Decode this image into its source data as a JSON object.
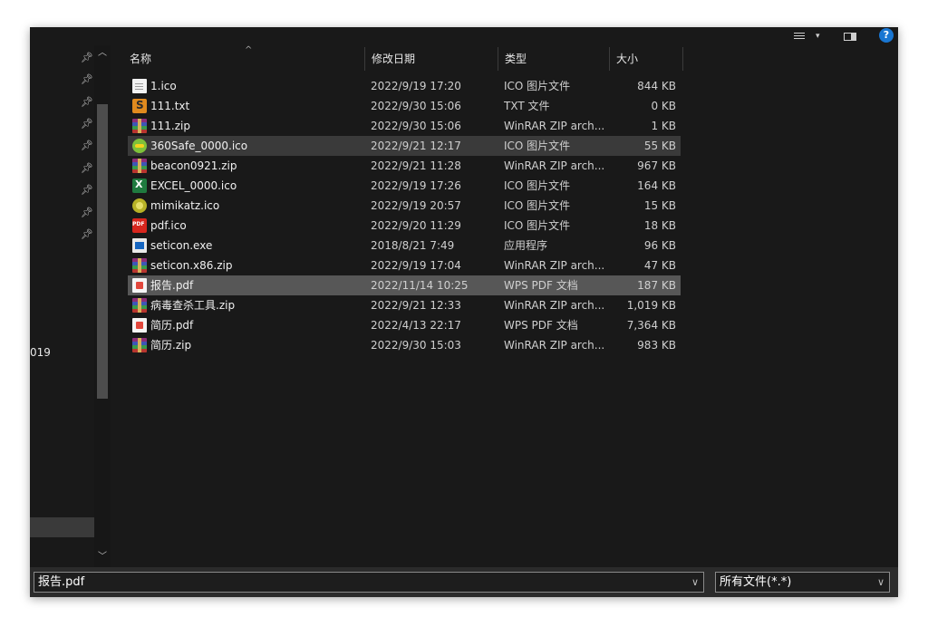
{
  "header": {
    "help_label": "?",
    "view_dropdown": "▾"
  },
  "nav": {
    "year_fragment": "019",
    "scroll_up": "︿",
    "scroll_down": "﹀"
  },
  "columns": {
    "name": "名称",
    "date": "修改日期",
    "type": "类型",
    "size": "大小",
    "sort_indicator": "^"
  },
  "files": [
    {
      "name": "1.ico",
      "date": "2022/9/19 17:20",
      "type": "ICO 图片文件",
      "size": "844 KB",
      "icon": "ico-doc-icon"
    },
    {
      "name": "111.txt",
      "date": "2022/9/30 15:06",
      "type": "TXT 文件",
      "size": "0 KB",
      "icon": "sublime-text-icon"
    },
    {
      "name": "111.zip",
      "date": "2022/9/30 15:06",
      "type": "WinRAR ZIP arch...",
      "size": "1 KB",
      "icon": "winrar-zip-icon"
    },
    {
      "name": "360Safe_0000.ico",
      "date": "2022/9/21 12:17",
      "type": "ICO 图片文件",
      "size": "55 KB",
      "icon": "360-safe-icon"
    },
    {
      "name": "beacon0921.zip",
      "date": "2022/9/21 11:28",
      "type": "WinRAR ZIP arch...",
      "size": "967 KB",
      "icon": "winrar-zip-icon"
    },
    {
      "name": "EXCEL_0000.ico",
      "date": "2022/9/19 17:26",
      "type": "ICO 图片文件",
      "size": "164 KB",
      "icon": "excel-icon"
    },
    {
      "name": "mimikatz.ico",
      "date": "2022/9/19 20:57",
      "type": "ICO 图片文件",
      "size": "15 KB",
      "icon": "kiwi-icon"
    },
    {
      "name": "pdf.ico",
      "date": "2022/9/20 11:29",
      "type": "ICO 图片文件",
      "size": "18 KB",
      "icon": "pdf-icon"
    },
    {
      "name": "seticon.exe",
      "date": "2018/8/21 7:49",
      "type": "应用程序",
      "size": "96 KB",
      "icon": "exe-icon"
    },
    {
      "name": "seticon.x86.zip",
      "date": "2022/9/19 17:04",
      "type": "WinRAR ZIP arch...",
      "size": "47 KB",
      "icon": "winrar-zip-icon"
    },
    {
      "name": "报告.pdf",
      "date": "2022/11/14 10:25",
      "type": "WPS PDF 文档",
      "size": "187 KB",
      "icon": "wps-pdf-icon"
    },
    {
      "name": "病毒查杀工具.zip",
      "date": "2022/9/21 12:33",
      "type": "WinRAR ZIP arch...",
      "size": "1,019 KB",
      "icon": "winrar-zip-icon"
    },
    {
      "name": "简历.pdf",
      "date": "2022/4/13 22:17",
      "type": "WPS PDF 文档",
      "size": "7,364 KB",
      "icon": "wps-pdf-icon"
    },
    {
      "name": "简历.zip",
      "date": "2022/9/30 15:03",
      "type": "WinRAR ZIP arch...",
      "size": "983 KB",
      "icon": "winrar-zip-icon"
    }
  ],
  "hovered_row": "360Safe_0000.ico",
  "selected_row": "报告.pdf",
  "bottom": {
    "filename_value": "报告.pdf",
    "filter_value": "所有文件(*.*)",
    "dropdown_chevron": "∨"
  },
  "colors": {
    "background": "#191919",
    "selected_row": "#575757",
    "hover_row": "#3a3a3a",
    "help_blue": "#1976d2"
  }
}
